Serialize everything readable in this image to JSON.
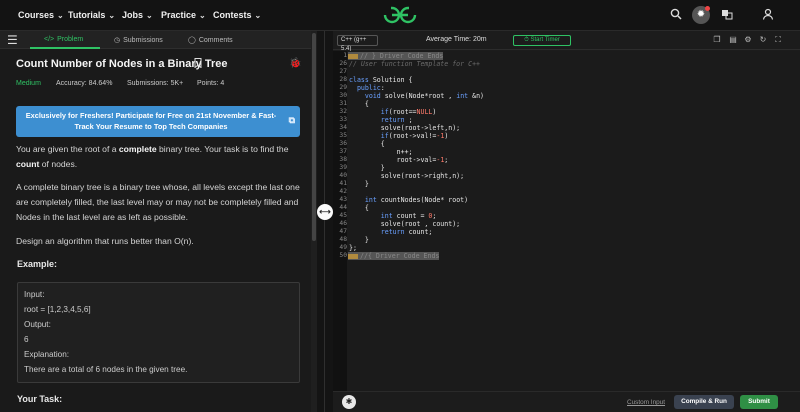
{
  "nav": {
    "items": [
      "Courses",
      "Tutorials",
      "Jobs",
      "Practice",
      "Contests"
    ],
    "chevron": "⌄",
    "logo_icon": "gfg-logo-icon",
    "right_icons": [
      "search-icon",
      "theme-icon",
      "translate-icon",
      "user-icon"
    ]
  },
  "tabs": [
    {
      "label": "Problem",
      "icon": "code-icon"
    },
    {
      "label": "Submissions",
      "icon": "clock-icon"
    },
    {
      "label": "Comments",
      "icon": "comment-icon"
    }
  ],
  "problem": {
    "title": "Count Number of Nodes in a Binary Tree",
    "difficulty": "Medium",
    "accuracy": "Accuracy: 84.64%",
    "submissions": "Submissions: 5K+",
    "points": "Points: 4",
    "banner": "Exclusively for Freshers! Participate for Free on 21st November & Fast-Track Your Resume to Top Tech Companies",
    "p1_a": "You are given the root of a ",
    "p1_b": "complete",
    "p1_c": " binary tree. Your task is to find the ",
    "p1_d": "count",
    "p1_e": " of nodes.",
    "p2": "A complete binary tree is a binary tree whose, all levels except the last one are completely filled, the last level may or may not be completely filled and Nodes in the last level are as left as possible.",
    "p3": "Design an algorithm that runs better than O(n).",
    "example_heading": "Example:",
    "example_lines": [
      "Input:",
      "root = [1,2,3,4,5,6]",
      "Output:",
      "6",
      "Explanation:",
      "There are a total of 6 nodes in the given tree."
    ],
    "your_task": "Your Task:"
  },
  "editor": {
    "language": "C++ (g++ 5.4)",
    "avg_time": "Average Time: 20m",
    "start_timer": "Start Timer",
    "toolbar_icons": [
      "copy-icon",
      "paste-icon",
      "settings-icon",
      "reset-icon",
      "fullscreen-icon"
    ],
    "line_numbers": [
      "1",
      "26",
      "27",
      "28",
      "29",
      "30",
      "31",
      "32",
      "33",
      "34",
      "35",
      "36",
      "37",
      "38",
      "39",
      "40",
      "41",
      "42",
      "43",
      "44",
      "45",
      "46",
      "47",
      "48",
      "49",
      "50"
    ],
    "custom_input": "Custom Input",
    "compile_run": "Compile & Run",
    "submit": "Submit"
  }
}
